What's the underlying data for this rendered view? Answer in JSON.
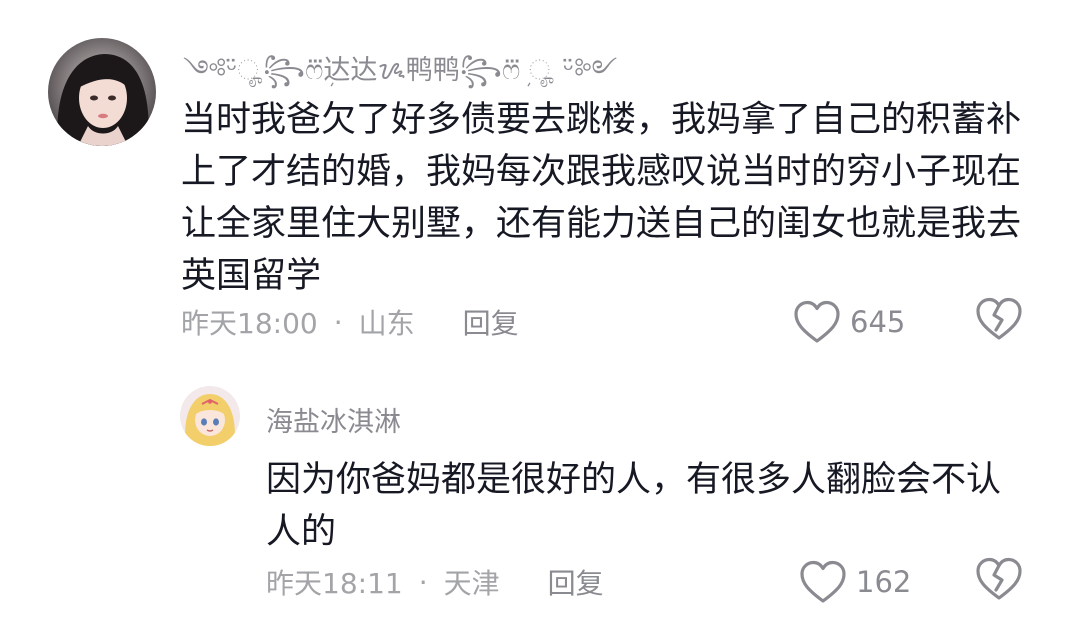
{
  "comments": [
    {
      "username": "༺ᵕ̈ೄ꧂ෆܼ⃛达达ᝰ鸭鸭꧂ෆܼ⃛ ೄ ᵕ̈༻",
      "text": "当时我爸欠了好多债要去跳楼，我妈拿了自己的积蓄补上了才结的婚，我妈每次跟我感叹说当时的穷小子现在让全家里住大别墅，还有能力送自己的闺女也就是我去英国留学",
      "time": "昨天18:00",
      "dot": "·",
      "location": "山东",
      "reply_label": "回复",
      "like_count": "645",
      "avatar_icon": "user-photo-avatar"
    },
    {
      "username": "海盐冰淇淋",
      "text": "因为你爸妈都是很好的人，有很多人翻脸会不认人的",
      "time": "昨天18:11",
      "dot": "·",
      "location": "天津",
      "reply_label": "回复",
      "like_count": "162",
      "avatar_icon": "anime-avatar"
    }
  ],
  "colors": {
    "text": "#161823",
    "secondary": "#8a8b91",
    "meta": "#a3a4a8",
    "icon": "#8a8b91"
  }
}
